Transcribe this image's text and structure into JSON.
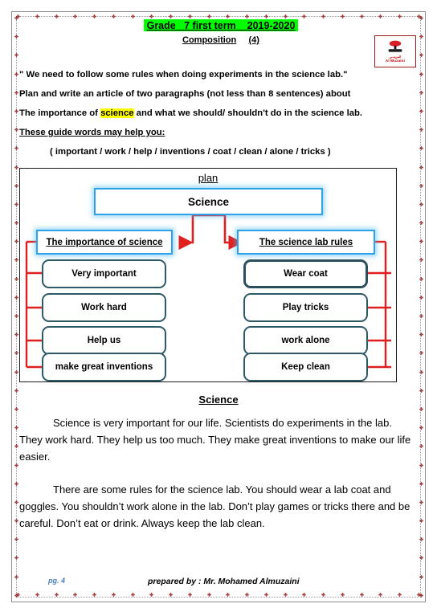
{
  "header": {
    "grade_line": "Grade   7 first term    2019-2020",
    "composition_label": "Composition",
    "composition_number": "(4)",
    "highlight_color": "#00ff00",
    "logo": {
      "name": "al-muzaini-logo",
      "arabic_text": "المزينــي",
      "english_text": "Al Muzaini",
      "color": "#c00000"
    }
  },
  "prompt": {
    "quote": "\" We need to follow some rules when doing experiments in the science lab.\"",
    "instruction": "Plan and write an article of two paragraphs (not less than 8 sentences) about",
    "topic_pre": "The importance of ",
    "topic_highlight": "science",
    "topic_post": " and what we should/ shouldn't do in the science lab.",
    "highlight_color": "#ffff00",
    "guide_heading": "These guide words may help you:",
    "guide_words": "( important  / work / help  / inventions  /  coat / clean /  alone / tricks )"
  },
  "mindmap": {
    "caption": "plan",
    "root": "Science",
    "branch_left": "The importance of science",
    "branch_right": "The science lab rules",
    "left_leaves": [
      "Very important",
      "Work hard",
      "Help us",
      "make great inventions"
    ],
    "right_leaves": [
      "Wear coat",
      "Play tricks",
      "work alone",
      "Keep clean"
    ],
    "colors": {
      "node_blue_border": "#2ea3e8",
      "leaf_border": "#2e5a68",
      "connector_red": "#e02020",
      "frame": "#1a1a1a"
    }
  },
  "essay": {
    "title": "Science",
    "paragraph1": "Science is very important for our life. Scientists do experiments in the lab. They work hard. They help us too much. They make great inventions to make our life easier.",
    "paragraph2": "There are some rules for the science lab. You should wear a lab coat and goggles. You shouldn’t work alone in the lab. Don’t play games or tricks there and be careful. Don’t eat or drink. Always keep the lab clean."
  },
  "footer": {
    "page_number": "pg. 4",
    "prepared_by": "prepared by : Mr. Mohamed Almuzaini",
    "page_number_color": "#4a7ebb"
  }
}
